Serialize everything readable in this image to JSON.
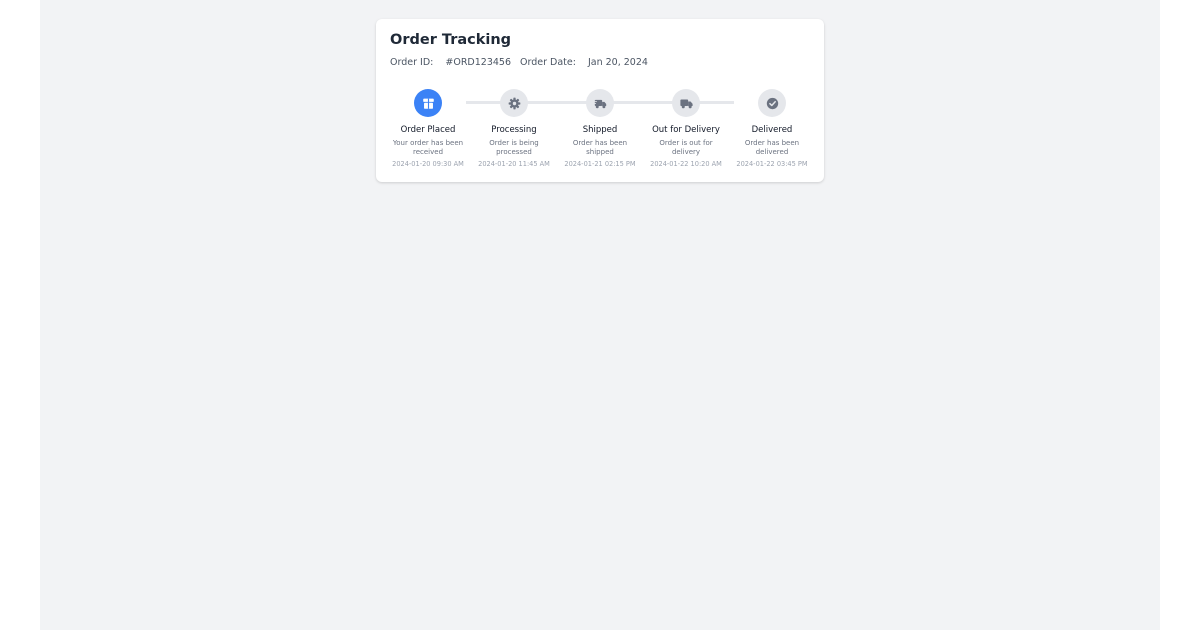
{
  "header": {
    "title": "Order Tracking",
    "order_id_label": "Order ID:",
    "order_id": "#ORD123456",
    "order_date_label": "Order Date:",
    "order_date": "Jan 20, 2024"
  },
  "colors": {
    "active": "#3b82f6",
    "inactive": "#e5e7eb",
    "inactive_icon": "#6b7280"
  },
  "steps": [
    {
      "title": "Order Placed",
      "description": "Your order has been received",
      "time": "2024-01-20 09:30 AM",
      "icon": "box-icon",
      "status": "completed"
    },
    {
      "title": "Processing",
      "description": "Order is being processed",
      "time": "2024-01-20 11:45 AM",
      "icon": "gear-icon",
      "status": "pending"
    },
    {
      "title": "Shipped",
      "description": "Order has been shipped",
      "time": "2024-01-21 02:15 PM",
      "icon": "shipping-truck-icon",
      "status": "pending"
    },
    {
      "title": "Out for Delivery",
      "description": "Order is out for delivery",
      "time": "2024-01-22 10:20 AM",
      "icon": "delivery-truck-icon",
      "status": "pending"
    },
    {
      "title": "Delivered",
      "description": "Order has been delivered",
      "time": "2024-01-22 03:45 PM",
      "icon": "check-circle-icon",
      "status": "pending"
    }
  ]
}
